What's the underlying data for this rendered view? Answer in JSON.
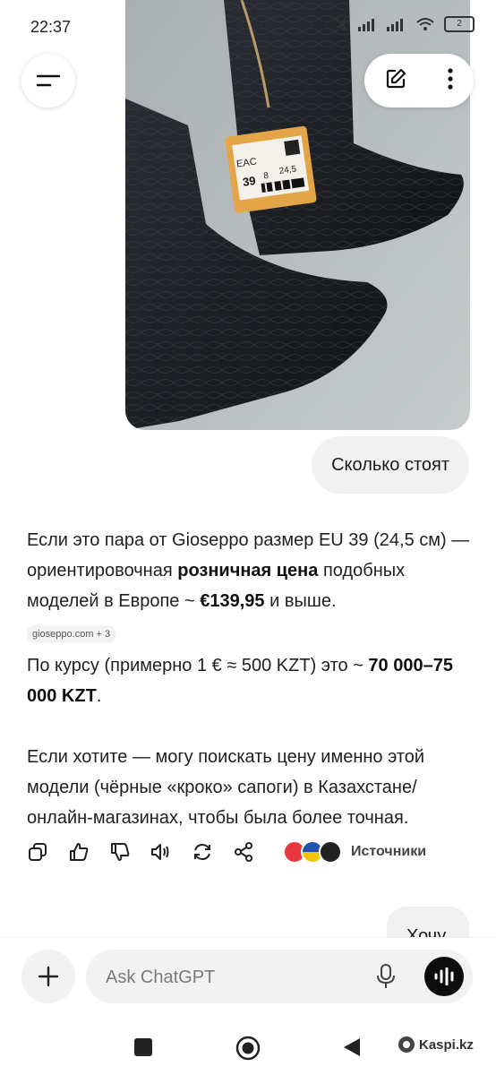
{
  "status_bar": {
    "time": "22:37",
    "battery": "2",
    "icons": [
      "mute-icon",
      "signal-icon",
      "signal-icon",
      "wifi-icon",
      "battery-icon"
    ]
  },
  "header": {
    "menu_icon": "menu-icon",
    "edit_icon": "edit-icon",
    "more_icon": "more-vertical-icon"
  },
  "image": {
    "price_tag": {
      "brand": "EAC",
      "size": "39",
      "code": "8",
      "cm": "24,5"
    }
  },
  "user_message": "Сколько стоят",
  "answer": {
    "p1_a": "Если это пара от Gioseppo размер EU 39 (24,5 см) — ориентировочная ",
    "p1_bold": "розничная цена",
    "p1_b": " подобных моделей в Европе ~ ",
    "p1_bold2": "€139,95",
    "p1_c": " и выше.",
    "source_chip": "gioseppo.com + 3",
    "p2_a": "По курсу (примерно 1 € ≈ 500 KZT) это ~ ",
    "p2_bold": "70 000–75 000 KZT",
    "p2_b": ".",
    "p3": "Если хотите — могу поискать цену именно этой модели (чёрные «кроко» сапоги) в Казахстане/онлайн-магазинах, чтобы была более точная."
  },
  "toolbar": {
    "icons": [
      "copy-icon",
      "thumbs-up-icon",
      "thumbs-down-icon",
      "speaker-icon",
      "regenerate-icon",
      "share-icon"
    ],
    "sources_label": "Источники",
    "source_logos": [
      "#e8383d",
      "#1f4fb5",
      "#222222"
    ]
  },
  "next_message_partial": "Хочу",
  "composer": {
    "placeholder": "Ask ChatGPT"
  },
  "watermark": "Kaspi.kz",
  "colors": {
    "accent_dark": "#0d0d0d",
    "bubble_bg": "#f1f1f1"
  }
}
